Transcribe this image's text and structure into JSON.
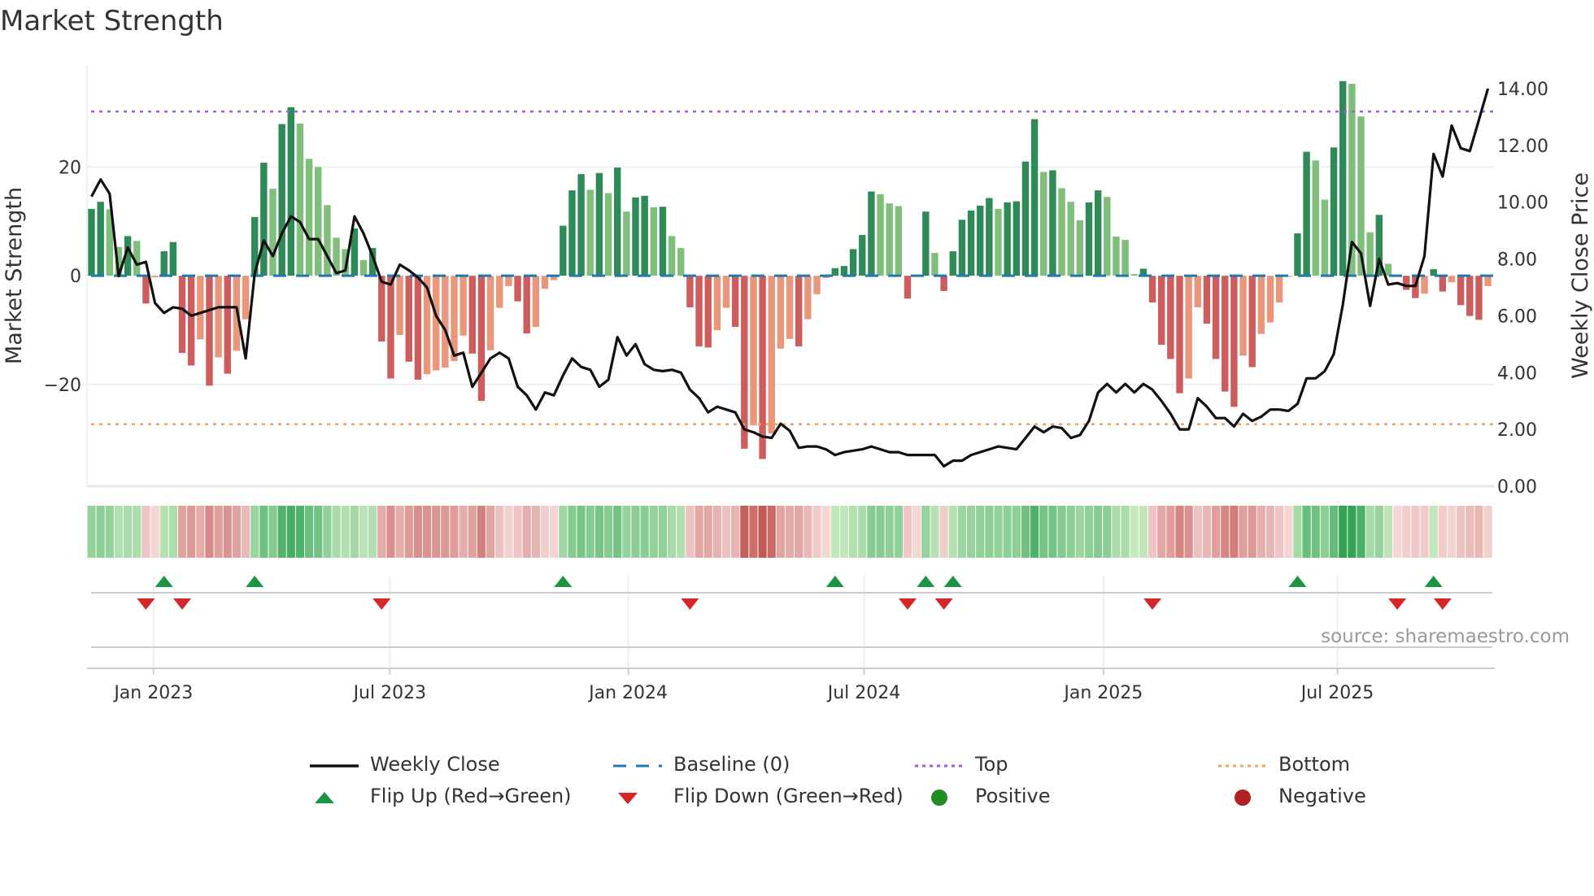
{
  "chart_data": {
    "type": "bar",
    "title": "Market Strength",
    "ylabel": "Market Strength",
    "y2label": "Weekly Close Price",
    "ylim": [
      -38.7,
      38.6
    ],
    "y2lim": [
      0,
      14.8
    ],
    "yticks": [
      {
        "v": 20,
        "label": "20"
      },
      {
        "v": 0,
        "label": "0"
      },
      {
        "v": -20,
        "label": "−20"
      }
    ],
    "y2ticks": [
      {
        "v": 0,
        "label": "0.00"
      },
      {
        "v": 2,
        "label": "2.00"
      },
      {
        "v": 4,
        "label": "4.00"
      },
      {
        "v": 6,
        "label": "6.00"
      },
      {
        "v": 8,
        "label": "8.00"
      },
      {
        "v": 10,
        "label": "10.00"
      },
      {
        "v": 12,
        "label": "12.00"
      },
      {
        "v": 14,
        "label": "14.00"
      }
    ],
    "xticks": [
      {
        "week": 6.84,
        "label": "Jan 2023"
      },
      {
        "week": 32.9,
        "label": "Jul 2023"
      },
      {
        "week": 59.2,
        "label": "Jan 2024"
      },
      {
        "week": 85.2,
        "label": "Jul 2024"
      },
      {
        "week": 111.6,
        "label": "Jan 2025"
      },
      {
        "week": 137.4,
        "label": "Jul 2025"
      }
    ],
    "top_level": 30.2,
    "bottom_level": -27.3,
    "strength": [
      12.3,
      13.6,
      12.2,
      5.3,
      7.3,
      6.4,
      -5.1,
      -0.3,
      4.5,
      6.2,
      -14.2,
      -16.5,
      -11.7,
      -20.2,
      -15.0,
      -18.0,
      -13.8,
      -8.0,
      10.8,
      20.8,
      16.0,
      27.9,
      31.0,
      28.0,
      21.5,
      20.0,
      13.0,
      7.0,
      4.9,
      8.7,
      2.9,
      5.1,
      -12.1,
      -18.9,
      -10.9,
      -15.8,
      -19.1,
      -18.1,
      -17.4,
      -16.9,
      -15.7,
      -11.0,
      -14.3,
      -23.0,
      -13.7,
      -5.9,
      -1.9,
      -4.7,
      -10.6,
      -9.4,
      -2.4,
      -0.8,
      9.2,
      15.7,
      18.7,
      15.8,
      18.9,
      15.2,
      19.9,
      11.8,
      14.4,
      14.7,
      12.6,
      12.7,
      7.3,
      5.1,
      -5.8,
      -13.0,
      -13.2,
      -10.0,
      -5.9,
      -9.4,
      -31.8,
      -27.5,
      -33.7,
      -29.0,
      -13.4,
      -11.6,
      -13.0,
      -8.0,
      -3.4,
      -0.4,
      1.4,
      1.8,
      4.9,
      7.5,
      15.5,
      15.0,
      13.3,
      12.8,
      -4.2,
      -0.2,
      11.8,
      4.2,
      -2.8,
      4.5,
      10.3,
      12.0,
      12.9,
      14.3,
      12.3,
      13.5,
      13.7,
      21.0,
      28.8,
      19.1,
      19.4,
      16.1,
      13.6,
      10.2,
      13.5,
      15.7,
      14.5,
      7.2,
      6.6,
      0.3,
      1.3,
      -4.9,
      -12.7,
      -15.3,
      -21.6,
      -18.9,
      -5.8,
      -8.8,
      -15.3,
      -21.3,
      -24.1,
      -14.7,
      -16.8,
      -10.7,
      -8.6,
      -4.9,
      -0.2,
      7.8,
      22.8,
      21.2,
      14.0,
      23.6,
      35.8,
      35.3,
      29.3,
      8.0,
      11.2,
      2.2,
      -0.2,
      -2.6,
      -4.1,
      -3.3,
      1.2,
      -2.9,
      -1.2,
      -5.4,
      -7.4,
      -8.1,
      -1.9
    ],
    "shade": "GGggGgRrGGRRrRrRrrGGgGGggggggGgGRRrRRrrrrrRRrrrRRrrrGGGgGgGgGGgGggRRRrrRRrRrrrRrrrGGGGGgggRrGgRGGGGGgGGGGgGgggGGggggGRRRRrrRRRRrRrrrrGGggGGgggGgrRRrGRrRRRr",
    "close": [
      10.2,
      10.8,
      10.3,
      7.4,
      8.4,
      7.8,
      7.9,
      6.45,
      6.1,
      6.3,
      6.25,
      6.0,
      6.1,
      6.2,
      6.3,
      6.3,
      6.3,
      4.5,
      7.5,
      8.65,
      8.1,
      8.9,
      9.5,
      9.3,
      8.7,
      8.7,
      8.1,
      7.5,
      7.6,
      9.5,
      8.9,
      8.1,
      7.2,
      7.1,
      7.8,
      7.6,
      7.35,
      7.0,
      6.0,
      5.5,
      4.6,
      4.7,
      3.5,
      4.0,
      4.5,
      4.7,
      4.5,
      3.5,
      3.2,
      2.7,
      3.3,
      3.2,
      3.9,
      4.5,
      4.2,
      4.1,
      3.5,
      3.75,
      5.25,
      4.6,
      5.0,
      4.3,
      4.1,
      4.05,
      4.1,
      4.0,
      3.4,
      3.1,
      2.6,
      2.8,
      2.7,
      2.6,
      2.0,
      1.9,
      1.75,
      1.7,
      2.2,
      1.95,
      1.35,
      1.4,
      1.4,
      1.3,
      1.1,
      1.2,
      1.25,
      1.3,
      1.4,
      1.3,
      1.2,
      1.2,
      1.1,
      1.1,
      1.1,
      1.1,
      0.7,
      0.9,
      0.9,
      1.1,
      1.2,
      1.3,
      1.4,
      1.35,
      1.3,
      1.7,
      2.1,
      1.9,
      2.1,
      2.05,
      1.7,
      1.8,
      2.3,
      3.3,
      3.6,
      3.3,
      3.6,
      3.3,
      3.6,
      3.4,
      3.0,
      2.55,
      2.0,
      2.0,
      3.1,
      2.8,
      2.4,
      2.4,
      2.1,
      2.55,
      2.3,
      2.45,
      2.7,
      2.7,
      2.65,
      2.9,
      3.8,
      3.8,
      4.05,
      4.65,
      6.4,
      8.6,
      8.2,
      6.35,
      8.0,
      7.1,
      7.15,
      7.05,
      7.05,
      8.1,
      11.7,
      10.9,
      12.7,
      11.9,
      11.8,
      12.9,
      14.0
    ],
    "flip_up": [
      8,
      18,
      52,
      82,
      92,
      95,
      133,
      148
    ],
    "flip_down": [
      6,
      10,
      32,
      66,
      90,
      94,
      117,
      144,
      149
    ],
    "colors": {
      "G": "#2e8b57",
      "g": "#7fbf7b",
      "R": "#cd5c5c",
      "r": "#e9967a",
      "line": "#111111",
      "baseline": "#1f77b4",
      "top": "#9b5de5",
      "bottom": "#f4a261",
      "flip_up": "#1a9641",
      "flip_down": "#d62728",
      "positive": "#228b22",
      "negative": "#b22222"
    },
    "legend": [
      {
        "key": "line",
        "label": "Weekly Close"
      },
      {
        "key": "baseline",
        "label": "Baseline (0)"
      },
      {
        "key": "top",
        "label": "Top"
      },
      {
        "key": "bottom",
        "label": "Bottom"
      },
      {
        "key": "flip_up",
        "label": "Flip Up (Red→Green)"
      },
      {
        "key": "flip_down",
        "label": "Flip Down (Green→Red)"
      },
      {
        "key": "positive",
        "label": "Positive"
      },
      {
        "key": "negative",
        "label": "Negative"
      }
    ],
    "legend_position": "bottom"
  },
  "source": "source: sharemaestro.com"
}
